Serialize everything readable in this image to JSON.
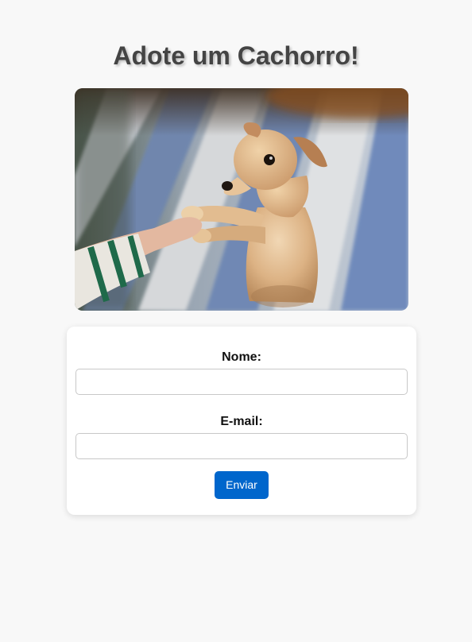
{
  "page": {
    "title": "Adote um Cachorro!"
  },
  "hero_image": {
    "subject": "dog-shaking-hand-photo"
  },
  "form": {
    "name_label": "Nome:",
    "name_value": "",
    "email_label": "E-mail:",
    "email_value": "",
    "submit_label": "Enviar"
  },
  "colors": {
    "background": "#f8f8f8",
    "title": "#444444",
    "card": "#ffffff",
    "button": "#0066cc",
    "button_text": "#ffffff"
  }
}
